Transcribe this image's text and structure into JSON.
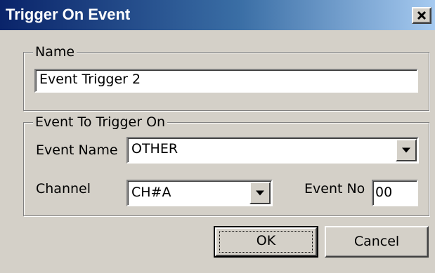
{
  "window": {
    "title": "Trigger On Event",
    "close_label": "Close"
  },
  "name_group": {
    "label": "Name",
    "value": "Event Trigger 2"
  },
  "event_group": {
    "label": "Event To Trigger On",
    "event_name_label": "Event Name",
    "event_name_value": "OTHER",
    "channel_label": "Channel",
    "channel_value": "CH#A",
    "event_no_label": "Event No",
    "event_no_value": "00"
  },
  "buttons": {
    "ok_label": "OK",
    "cancel_label": "Cancel"
  },
  "icons": {
    "close": "close-icon",
    "dropdown": "chevron-down-icon"
  },
  "colors": {
    "title_start": "#0a246a",
    "title_end": "#a6caf0",
    "face": "#d4d0c8"
  }
}
